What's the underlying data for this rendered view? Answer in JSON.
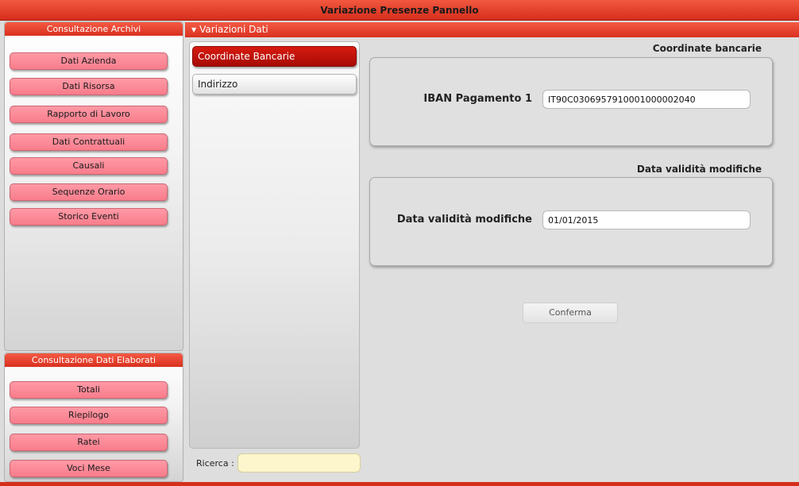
{
  "window": {
    "title": "Variazione Presenze Pannello"
  },
  "archive_panel": {
    "title": "Consultazione Archivi",
    "items": [
      {
        "label": "Dati Azienda"
      },
      {
        "label": "Dati Risorsa"
      },
      {
        "label": "Rapporto di Lavoro"
      },
      {
        "label": "Dati Contrattuali"
      },
      {
        "label": "Causali"
      },
      {
        "label": "Sequenze Orario"
      },
      {
        "label": "Storico Eventi"
      }
    ]
  },
  "processed_panel": {
    "title": "Consultazione Dati Elaborati",
    "items": [
      {
        "label": "Totali"
      },
      {
        "label": "Riepilogo"
      },
      {
        "label": "Ratei"
      },
      {
        "label": "Voci Mese"
      }
    ]
  },
  "main": {
    "header": "Variazioni Dati",
    "list": [
      {
        "label": "Coordinate Bancarie",
        "active": true
      },
      {
        "label": "Indirizzo",
        "active": false
      }
    ],
    "search": {
      "label": "Ricerca :",
      "value": ""
    },
    "bank_section": {
      "title": "Coordinate bancarie",
      "field_label": "IBAN Pagamento 1",
      "field_value": "IT90C0306957910001000002040"
    },
    "validity_section": {
      "title": "Data validità modifiche",
      "field_label": "Data validità modifiche",
      "field_value": "01/01/2015"
    },
    "confirm_label": "Conferma"
  },
  "colors": {
    "header_red": "#d9301f",
    "menu_pink": "#f87c8b",
    "active_item": "#c2140b",
    "search_yellow": "#fdf6cd"
  }
}
